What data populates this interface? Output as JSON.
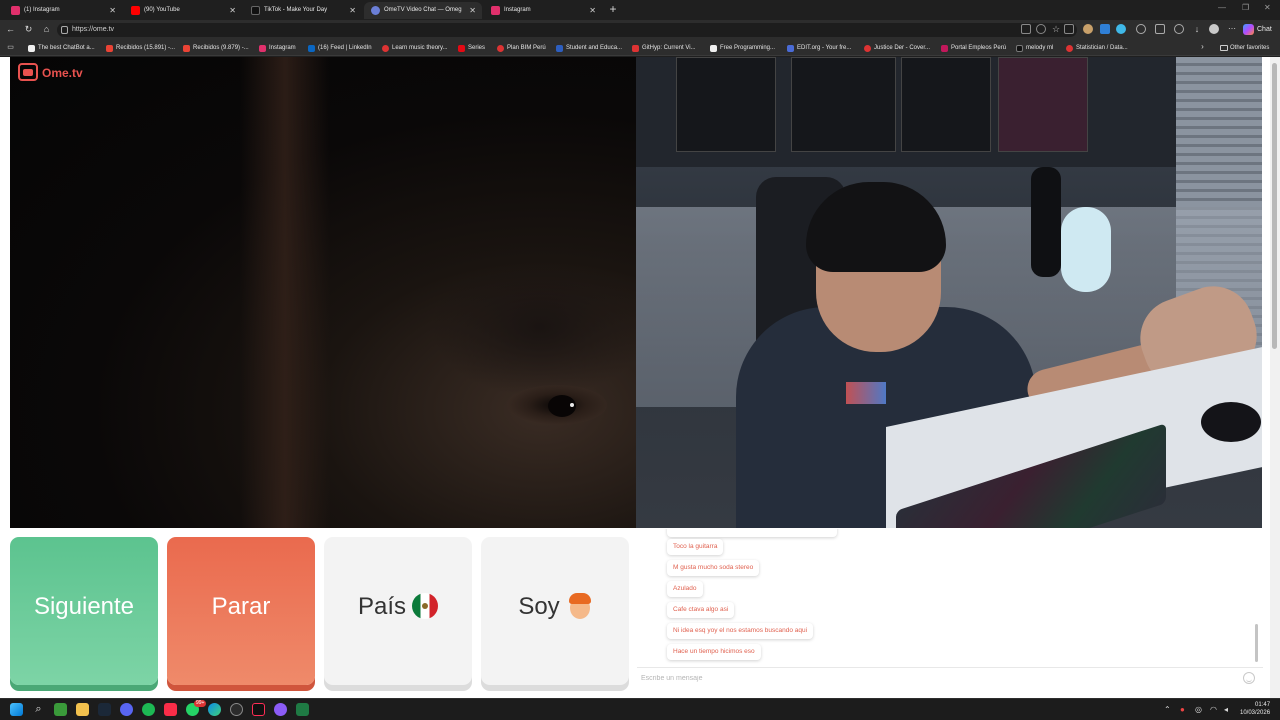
{
  "tabs": [
    {
      "label": "(1) Instagram",
      "color": "#e1306c"
    },
    {
      "label": "(90) YouTube",
      "color": "#ff0000"
    },
    {
      "label": "TikTok - Make Your Day",
      "color": "#111111"
    },
    {
      "label": "OmeTV Video Chat — Omeg",
      "color": "#6b7fd7"
    },
    {
      "label": "Instagram",
      "color": "#e1306c"
    }
  ],
  "address": {
    "url": "https://ome.tv"
  },
  "toolbar": {
    "chat_label": "Chat"
  },
  "bookmarks": [
    {
      "label": "The best ChatBot a...",
      "color": "#f0f0f0"
    },
    {
      "label": "Recibidos (15.891) -...",
      "color": "#ea4335"
    },
    {
      "label": "Recibidos (9.879) -...",
      "color": "#ea4335"
    },
    {
      "label": "Instagram",
      "color": "#e1306c"
    },
    {
      "label": "(16) Feed | LinkedIn",
      "color": "#0a66c2"
    },
    {
      "label": "Learn music theory...",
      "color": "#d33"
    },
    {
      "label": "Series",
      "color": "#e50914"
    },
    {
      "label": "Plan BIM Perú",
      "color": "#d33"
    },
    {
      "label": "Student and Educa...",
      "color": "#2d5ebf"
    },
    {
      "label": "GitHyp: Current Vi...",
      "color": "#d33"
    },
    {
      "label": "Free Programming...",
      "color": "#f0f0f0"
    },
    {
      "label": "EDIT.org - Your fre...",
      "color": "#4a6bd6"
    },
    {
      "label": "Justice Der - Cover...",
      "color": "#d33"
    },
    {
      "label": "Portal Empleos Perú",
      "color": "#c2185b"
    },
    {
      "label": "melody ml",
      "color": "#111"
    },
    {
      "label": "Statistician / Data...",
      "color": "#d33"
    }
  ],
  "other_favorites": "Other favorites",
  "logo": {
    "text": "Ome.tv"
  },
  "buttons": {
    "next": "Siguiente",
    "stop": "Parar",
    "country": "País",
    "gender": "Soy"
  },
  "chat": {
    "messages": [
      "Toco la guitarra",
      "M gusta mucho soda stereo",
      "Azulado",
      "Cafe ctava algo asi",
      "Ni idea esq yoy el nos estamos buscando aqui",
      "Hace un tiempo hicimos eso"
    ],
    "placeholder": "Escribe un mensaje"
  },
  "taskbar": {
    "time": "01:47",
    "date": "10/03/2026",
    "badge": "99+"
  }
}
